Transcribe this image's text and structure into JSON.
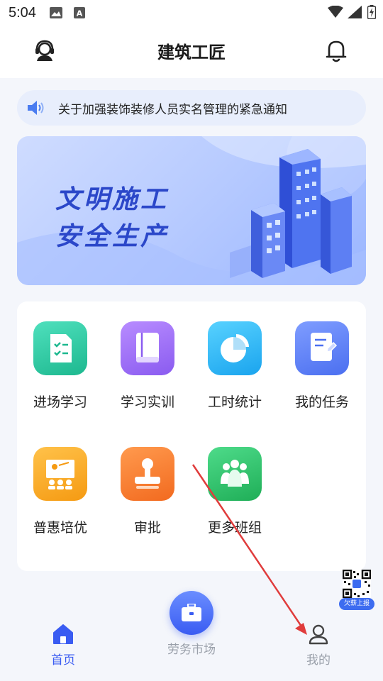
{
  "status_bar": {
    "time": "5:04"
  },
  "header": {
    "title": "建筑工匠"
  },
  "notice": {
    "text": "关于加强装饰装修人员实名管理的紧急通知"
  },
  "banner": {
    "line1": "文明施工",
    "line2": "安全生产"
  },
  "grid": {
    "items": [
      {
        "label": "进场学习",
        "icon": "checklist-icon",
        "color": "#2cc6a3"
      },
      {
        "label": "学习实训",
        "icon": "book-icon",
        "color": "#9c6cf5"
      },
      {
        "label": "工时统计",
        "icon": "pie-chart-icon",
        "color": "#2fb6f5"
      },
      {
        "label": "我的任务",
        "icon": "edit-document-icon",
        "color": "#5a7ff5"
      },
      {
        "label": "普惠培优",
        "icon": "training-class-icon",
        "color": "#f5a623"
      },
      {
        "label": "审批",
        "icon": "stamp-icon",
        "color": "#f57a33"
      },
      {
        "label": "更多班组",
        "icon": "team-icon",
        "color": "#2dc26b"
      }
    ]
  },
  "bottom_nav": {
    "home_label": "首页",
    "market_label": "劳务市场",
    "mine_label": "我的"
  },
  "qr_widget": {
    "badge": "欠薪上报"
  },
  "colors": {
    "accent": "#3a5cf2",
    "nav_active": "#3a5cf2",
    "nav_inactive": "#9aa0aa",
    "arrow": "#e03c3c"
  }
}
